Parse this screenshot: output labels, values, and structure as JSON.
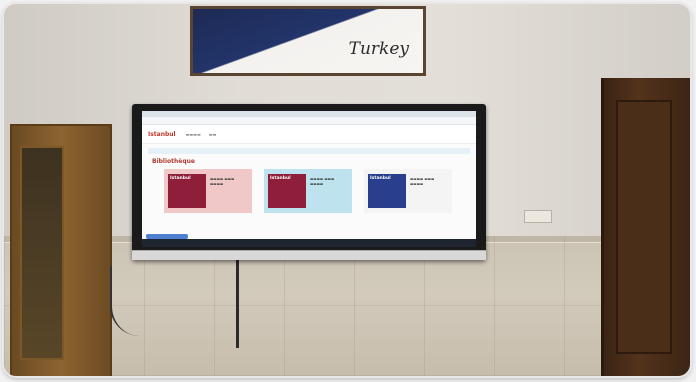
{
  "scene": {
    "poster": {
      "brand_text": "Turkey",
      "colors": {
        "frame": "#5a4533",
        "top": "#1d2a54",
        "bottom": "#f4f2ef"
      }
    },
    "tv_screen": {
      "site_logo": "Istanbul",
      "section_title": "Bibliothèque",
      "cards": [
        {
          "thumb_label": "Istanbul",
          "color": "#f0c8c8",
          "thumb_color": "#8e1e3a"
        },
        {
          "thumb_label": "Istanbul",
          "color": "#bfe3ee",
          "thumb_color": "#8e1e3a"
        },
        {
          "thumb_label": "Istanbul",
          "color": "#f4f4f4",
          "thumb_color": "#2a3e8e"
        }
      ]
    },
    "colors": {
      "wall": "#e1ddd6",
      "wood": "#8c6430",
      "door": "#53331b"
    }
  }
}
